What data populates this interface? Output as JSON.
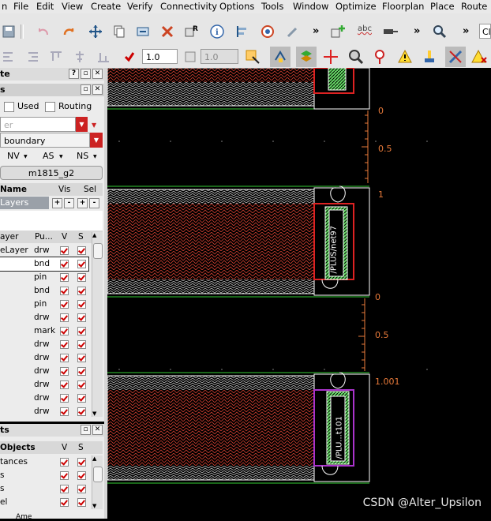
{
  "menus": [
    "File",
    "Edit",
    "View",
    "Create",
    "Verify",
    "Connectivity",
    "Options",
    "Tools",
    "Window",
    "Optimize",
    "Floorplan",
    "Place",
    "Route"
  ],
  "toolbar": {
    "search_partial": "Cl",
    "more1": "»",
    "more2": "»",
    "more3": "»",
    "spin1_value": "1.0",
    "spin2_value": "1.0",
    "abc": "abc"
  },
  "palette": {
    "title": "te",
    "sub_title": "s",
    "used_label": "Used",
    "routing_label": "Routing",
    "filter_placeholder": "er",
    "boundary_value": "boundary",
    "nv": "NV",
    "as": "AS",
    "ns": "NS",
    "lpp_button": "m1815_g2",
    "hdr_name": "Name",
    "hdr_vis": "Vis",
    "hdr_sel": "Sel",
    "layers_label": "Layers",
    "plusminus": [
      "+",
      "-",
      "+",
      "-"
    ],
    "hdr2_layer": "ayer",
    "hdr2_pu": "Pu...",
    "hdr2_v": "V",
    "hdr2_s": "S",
    "layers": [
      {
        "n": "eLayer",
        "p": "drw"
      },
      {
        "n": "",
        "p": "bnd"
      },
      {
        "n": "",
        "p": "pin"
      },
      {
        "n": "",
        "p": "bnd"
      },
      {
        "n": "",
        "p": "pin"
      },
      {
        "n": "",
        "p": "drw"
      },
      {
        "n": "",
        "p": "mark"
      },
      {
        "n": "",
        "p": "drw"
      },
      {
        "n": "",
        "p": "drw"
      },
      {
        "n": "",
        "p": "drw"
      },
      {
        "n": "",
        "p": "drw"
      },
      {
        "n": "",
        "p": "drw"
      },
      {
        "n": "",
        "p": "drw"
      }
    ]
  },
  "objects": {
    "title": "ts",
    "hdr": "Objects",
    "v": "V",
    "s": "S",
    "rows": [
      "tances",
      "s",
      "s",
      "el"
    ],
    "bottom": "Ame"
  },
  "canvas": {
    "labels": [
      "0",
      "0.5",
      "1",
      "0",
      "0.5",
      "1.001"
    ],
    "pin_labels": [
      "/PLUS/net97",
      "/PLU...t101"
    ]
  },
  "watermark": "CSDN @Alter_Upsilon"
}
